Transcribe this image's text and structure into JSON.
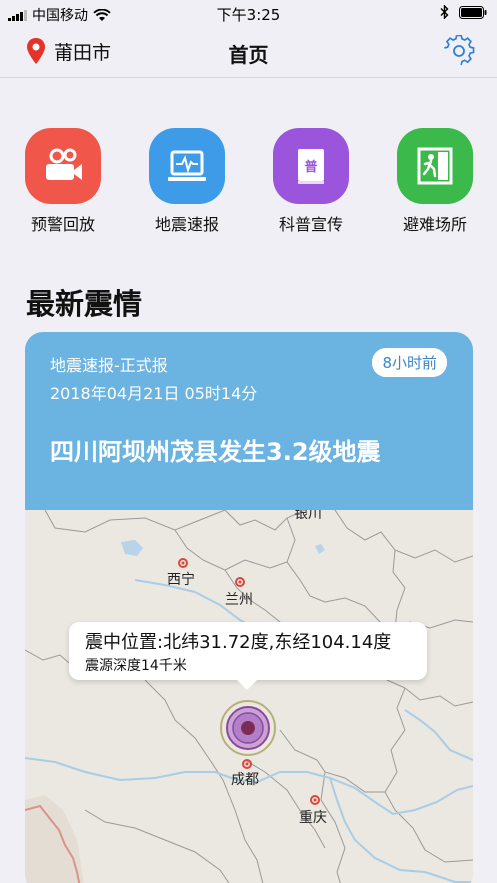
{
  "status_bar": {
    "carrier": "中国移动",
    "time": "下午3:25"
  },
  "nav": {
    "location": "莆田市",
    "title": "首页"
  },
  "shortcuts": [
    {
      "label": "预警回放",
      "icon": "video-camera-icon",
      "color": "#f0574a"
    },
    {
      "label": "地震速报",
      "icon": "monitor-waveform-icon",
      "color": "#3d9be8"
    },
    {
      "label": "科普宣传",
      "icon": "book-icon",
      "color": "#9b54dc"
    },
    {
      "label": "避难场所",
      "icon": "exit-door-icon",
      "color": "#3bb94a"
    }
  ],
  "section_title": "最新震情",
  "quake_card": {
    "type": "地震速报-正式报",
    "time": "2018年04月21日 05时14分",
    "badge": "8小时前",
    "headline": "四川阿坝州茂县发生3.2级地震",
    "tooltip": {
      "location": "震中位置:北纬31.72度,东经104.14度",
      "depth": "震源深度14千米"
    },
    "map_cities": [
      "银川",
      "西宁",
      "兰州",
      "成都",
      "重庆"
    ]
  },
  "colors": {
    "card_header": "#6bb3e0",
    "badge_text": "#3b86c7",
    "location_pin": "#e5332a",
    "settings_icon": "#2d7fd3"
  }
}
